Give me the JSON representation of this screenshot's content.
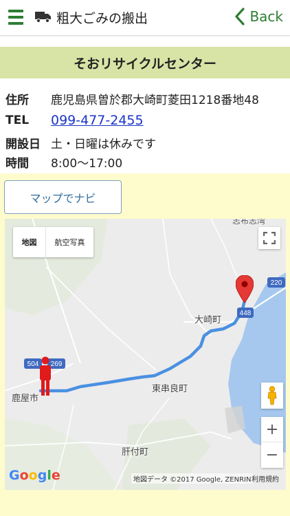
{
  "header": {
    "title": "粗大ごみの搬出",
    "menu_icon": "hamburger-menu-icon",
    "category_icon": "truck-icon",
    "back_label": "Back"
  },
  "facility": {
    "name": "そおリサイクルセンター",
    "rows": [
      {
        "label": "住所",
        "value": "鹿児島県曽於郡大崎町菱田1218番地48"
      },
      {
        "label": "TEL",
        "value": "099-477-2455"
      },
      {
        "label": "開設日",
        "value": "土・日曜は休みです"
      },
      {
        "label": "時間",
        "value": "8:00〜17:00"
      }
    ]
  },
  "navi_button": "マップでナビ",
  "map": {
    "type_map": "地図",
    "type_satellite": "航空写真",
    "places": {
      "osaki": "大崎町",
      "kanoya": "鹿屋市",
      "higashikushira": "東串良町",
      "kimotsuki": "肝付町",
      "top_partial": "志布志湾"
    },
    "routes": {
      "r448": "448",
      "r220": "220",
      "r504": "504",
      "r269": "269"
    },
    "google": "Google",
    "attribution": "地図データ ©2017 Google, ZENRIN",
    "terms": "利用規約",
    "zoom_in": "+",
    "zoom_out": "−"
  },
  "colors": {
    "accent_green": "#2e7d32",
    "title_bar": "#d7e4a6",
    "lower_bg": "#fefccc",
    "link": "#1a34c8",
    "route": "#4a90e2",
    "sea": "#a6c8ef",
    "pin": "#e53935"
  }
}
